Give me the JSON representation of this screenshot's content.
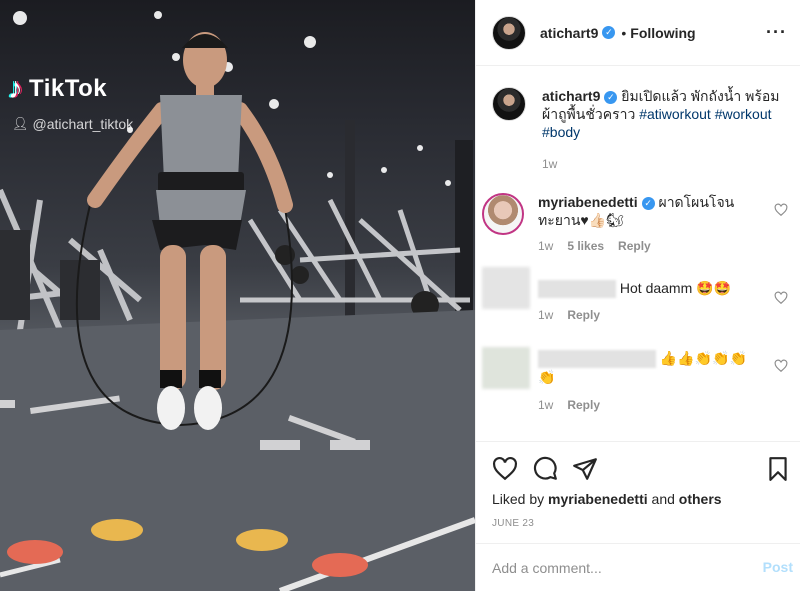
{
  "media": {
    "watermark_word": "TikTok",
    "watermark_note": "♪",
    "handle": "@atichart_tiktok",
    "person_icon": "user-icon"
  },
  "header": {
    "username": "atichart9",
    "separator": "•",
    "follow_status": "Following",
    "verified_icon": "verified-badge-icon",
    "more_icon": "more-options-icon"
  },
  "caption": {
    "username": "atichart9",
    "text": "ยิมเปิดแล้ว พักถังน้ำ พร้อม ผ้าถูพื้นชั่วคราว",
    "hashtags": [
      "#atiworkout",
      "#workout",
      "#body"
    ],
    "time": "1w"
  },
  "comments": [
    {
      "username": "myriabenedetti",
      "text": "ผาดโผนโจน ทะยาน♥👍🏻🐿",
      "time": "1w",
      "likes": "5 likes",
      "reply": "Reply",
      "verified": true
    },
    {
      "username": "",
      "text": "Hot daamm 🤩🤩",
      "time": "1w",
      "reply": "Reply"
    },
    {
      "username": "",
      "text": "👍👍👏👏👏 👏",
      "time": "1w",
      "reply": "Reply"
    }
  ],
  "actions": {
    "icons": [
      "heart-icon",
      "comment-icon",
      "share-icon",
      "bookmark-icon"
    ],
    "liked_by_prefix": "Liked by",
    "liked_by_user": "myriabenedetti",
    "liked_by_and": "and",
    "liked_by_others": "others",
    "date": "JUNE 23"
  },
  "composer": {
    "placeholder": "Add a comment...",
    "post_label": "Post"
  },
  "colors": {
    "link": "#00376b",
    "verified": "#3897f0",
    "post_disabled": "#b2dffc",
    "muted": "#8e8e8e"
  }
}
